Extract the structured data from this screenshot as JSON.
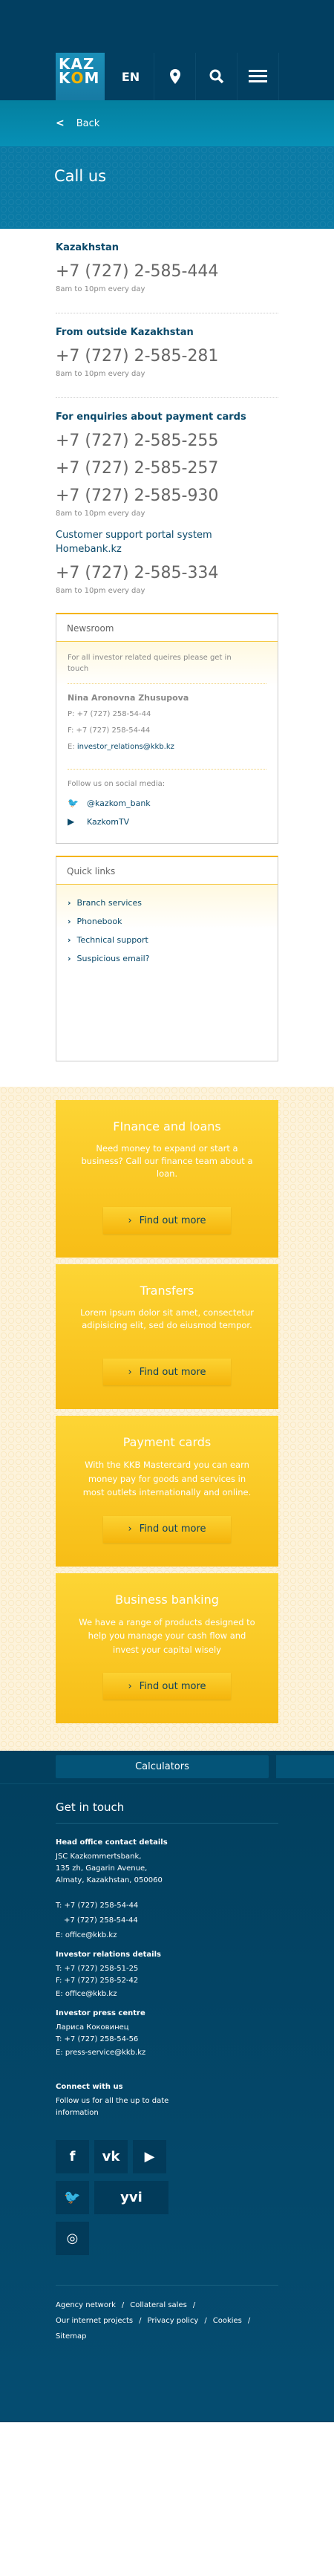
{
  "header": {
    "logo_top": "KAZ",
    "logo_bottom_k": "K",
    "logo_bottom_o": "O",
    "logo_bottom_m": "M",
    "language": "EN",
    "icons": [
      "location-pin-icon",
      "search-icon",
      "menu-icon"
    ]
  },
  "back_label": "Back",
  "page_title": "Call us",
  "hours": "8am to 10pm every day",
  "contacts": [
    {
      "heading": "Kazakhstan",
      "phones": [
        "+7 (727) 2-585-444"
      ]
    },
    {
      "heading": "From outside Kazakhstan",
      "phones": [
        "+7 (727) 2-585-281"
      ]
    },
    {
      "heading": "For enquiries about payment cards",
      "phones": [
        "+7 (727) 2-585-255",
        "+7 (727) 2-585-257",
        "+7 (727) 2-585-930"
      ]
    },
    {
      "heading": "Customer support portal system Homebank.kz",
      "phones": [
        "+7 (727) 2-585-334"
      ]
    }
  ],
  "newsroom": {
    "title": "Newsroom",
    "intro": "For all investor related queires please get in touch",
    "name": "Nina Aronovna Zhusupova",
    "phone": "P: +7 (727) 258-54-44",
    "fax": "F: +7 (727) 258-54-44",
    "email_label": "E:",
    "email": "investor_relations@kkb.kz",
    "follow": "Follow us on social media:",
    "twitter": "@kazkom_bank",
    "youtube": "KazkomTV"
  },
  "quick_links": {
    "title": "Quick links",
    "items": [
      "Branch services",
      "Phonebook",
      "Technical support",
      "Suspicious email?"
    ]
  },
  "cards": [
    {
      "title": "FInance and loans",
      "text": "Need money to expand or start a business? Call our finance team about a loan.",
      "button": "Find out more"
    },
    {
      "title": "Transfers",
      "text": "Lorem ipsum dolor sit amet, consectetur adipisicing elit, sed do eiusmod tempor.",
      "button": "Find out more"
    },
    {
      "title": "Payment cards",
      "text": "With the KKB Mastercard you can earn money pay for goods and services in most outlets internationally and online.",
      "button": "Find out more"
    },
    {
      "title": "Business banking",
      "text": "We have a range of products designed to help you manage your cash flow and invest your capital wisely",
      "button": "Find out more"
    }
  ],
  "footer": {
    "calculators": "Calculators",
    "get_in_touch": "Get in touch",
    "head_office": {
      "title": "Head office contact details",
      "address": [
        "JSC Kazkommertsbank,",
        "135 zh, Gagarin Avenue,",
        "Almaty, Kazakhstan, 050060"
      ],
      "t1": "T: +7 (727) 258-54-44",
      "t2": "+7 (727) 258-54-44",
      "email": "E: office@kkb.kz"
    },
    "investor": {
      "title": "Investor relations details",
      "t": "T: +7 (727) 258-51-25",
      "f": "F: +7 (727) 258-52-42",
      "email": "E: office@kkb.kz"
    },
    "press": {
      "title": "Investor press centre",
      "name": "Лариса Коковинец",
      "t": "T: +7 (727) 258-54-56",
      "email": "E: press-service@kkb.kz"
    },
    "connect": {
      "title": "Connect with us",
      "text": "Follow us for all the up to date information",
      "yvi": "yvi"
    },
    "links": [
      "Agency network",
      "Collateral sales",
      "Our internet projects",
      "Privacy policy",
      "Cookies",
      "Sitemap"
    ]
  },
  "colors": {
    "navy": "#023f61",
    "teal": "#0790b6",
    "yellow": "#f7bd16",
    "cream": "#fdf3dc"
  }
}
